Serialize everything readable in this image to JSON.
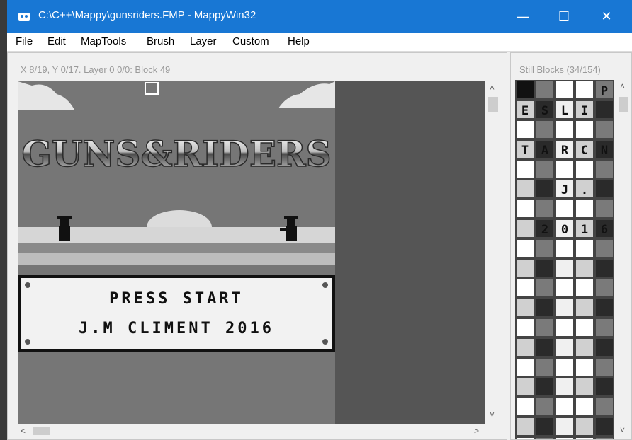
{
  "window": {
    "title": "C:\\C++\\Mappy\\gunsriders.FMP - MappyWin32",
    "minimize_glyph": "—",
    "maximize_glyph": "☐",
    "close_glyph": "✕"
  },
  "menu": [
    "File",
    "Edit",
    "MapTools",
    "Brush",
    "Layer",
    "Custom",
    "Help"
  ],
  "map": {
    "status": "X 8/19, Y 0/17. Layer 0 0/0: Block 49",
    "game_title": "GUNS&RIDERS",
    "press_start": "PRESS START",
    "credit": "J.M CLIMENT 2016"
  },
  "blocks": {
    "title": "Still Blocks (34/154)",
    "rows": [
      [
        "",
        "",
        "",
        "",
        "P"
      ],
      [
        "E",
        "S",
        "L",
        "I",
        ""
      ],
      [
        "",
        "",
        "",
        "",
        ""
      ],
      [
        "T",
        "A",
        "R",
        "C",
        "N"
      ],
      [
        "",
        "",
        "",
        "",
        ""
      ],
      [
        "",
        "",
        "J",
        ".",
        ""
      ],
      [
        "",
        "",
        "",
        "",
        ""
      ],
      [
        "",
        "2",
        "0",
        "1",
        "6"
      ]
    ]
  },
  "scroll": {
    "up": "˄",
    "down": "˅",
    "left": "<",
    "right": ">"
  },
  "icons": {
    "app": "mappy-app-icon",
    "minimize": "minimize-icon",
    "maximize": "maximize-icon",
    "close": "close-icon"
  }
}
